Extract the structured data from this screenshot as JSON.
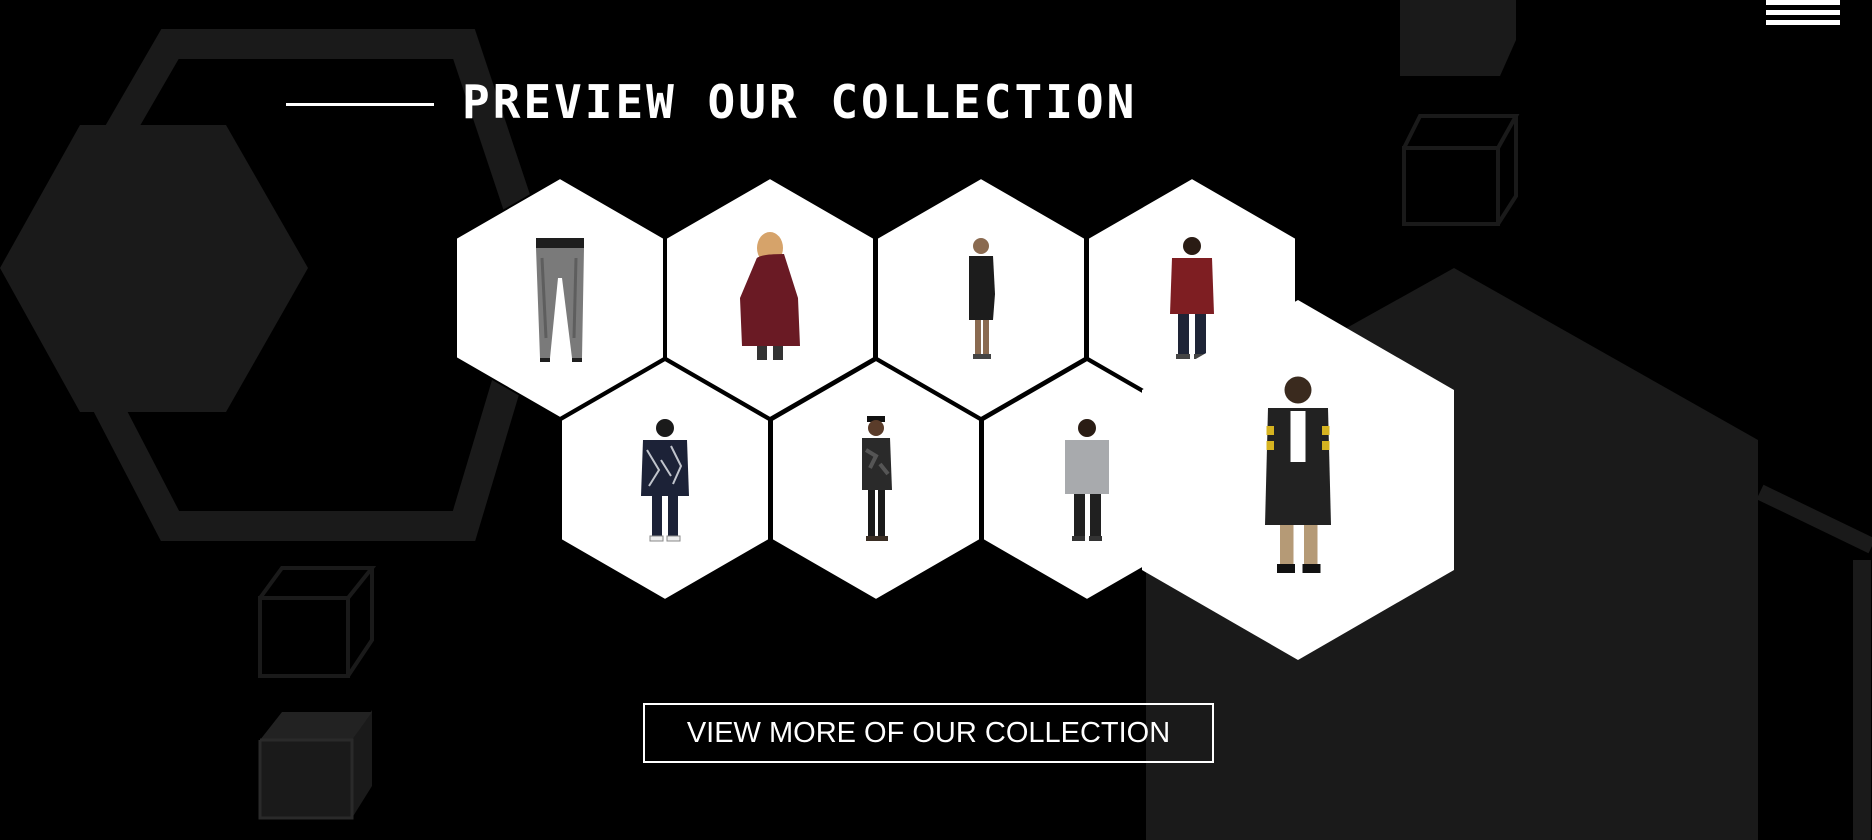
{
  "header": {
    "menu_icon": "hamburger-menu-icon",
    "title": "PREVIEW OUR COLLECTION"
  },
  "collection": {
    "items": [
      {
        "name": "product-gray-joggers",
        "icon": "jogger-pants-icon",
        "colors": {
          "primary": "#7a7a7a",
          "accent": "#1e1e1e"
        }
      },
      {
        "name": "product-burgundy-cardigan",
        "icon": "cardigan-icon",
        "colors": {
          "primary": "#6a1a24",
          "accent": "#d6a36a"
        }
      },
      {
        "name": "product-black-tee-shorts",
        "icon": "tee-shorts-icon",
        "colors": {
          "primary": "#1c1c1c",
          "accent": "#8a6a50"
        }
      },
      {
        "name": "product-red-shirt",
        "icon": "red-shirt-icon",
        "colors": {
          "primary": "#7e1e22",
          "accent": "#1e2436"
        }
      },
      {
        "name": "product-navy-print-jacket",
        "icon": "print-jacket-icon",
        "colors": {
          "primary": "#1c2237",
          "accent": "#c0c4cc"
        }
      },
      {
        "name": "product-camo-jacket",
        "icon": "camo-jacket-icon",
        "colors": {
          "primary": "#2a2a2a",
          "accent": "#555555"
        }
      },
      {
        "name": "product-gray-shirt",
        "icon": "gray-shirt-icon",
        "colors": {
          "primary": "#a8aaad",
          "accent": "#202020"
        }
      },
      {
        "name": "product-striped-overcoat",
        "icon": "overcoat-icon",
        "colors": {
          "primary": "#222222",
          "accent": "#d6b320"
        }
      }
    ]
  },
  "cta": {
    "label": "VIEW MORE OF OUR COLLECTION"
  },
  "theme": {
    "background": "#000000",
    "decor": "#1a1a1a",
    "hex_fill": "#ffffff",
    "text": "#ffffff"
  }
}
